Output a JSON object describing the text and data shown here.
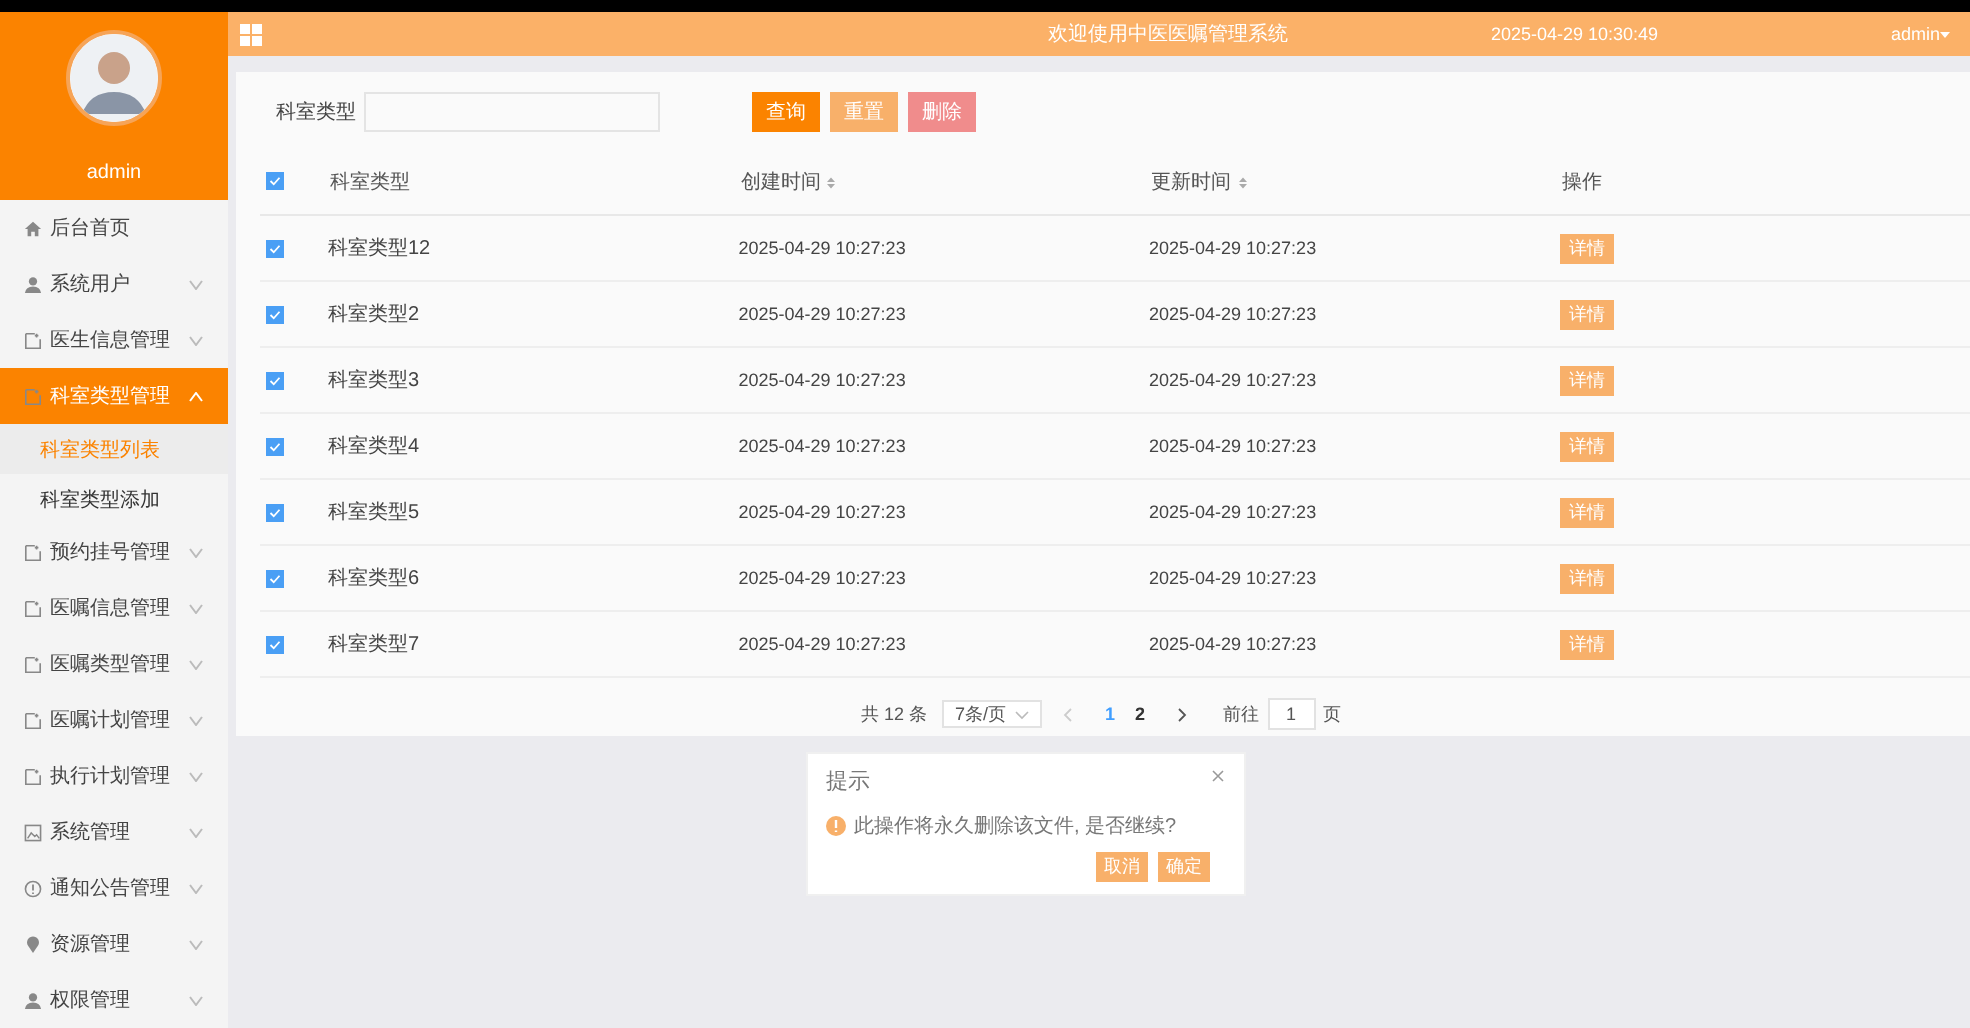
{
  "topbar": {
    "title": "欢迎使用中医医嘱管理系统",
    "datetime": "2025-04-29 10:30:49",
    "user": "admin"
  },
  "sidebar": {
    "username": "admin",
    "items": [
      {
        "label": "后台首页",
        "kind": "link",
        "selected": false
      },
      {
        "label": "系统用户",
        "kind": "submenu",
        "expanded": false,
        "selected": false
      },
      {
        "label": "医生信息管理",
        "kind": "submenu",
        "expanded": false,
        "selected": false
      },
      {
        "label": "科室类型管理",
        "kind": "submenu",
        "expanded": true,
        "selected": true,
        "children": [
          {
            "label": "科室类型列表",
            "selected": true
          },
          {
            "label": "科室类型添加",
            "selected": false
          }
        ]
      },
      {
        "label": "预约挂号管理",
        "kind": "submenu",
        "expanded": false,
        "selected": false
      },
      {
        "label": "医嘱信息管理",
        "kind": "submenu",
        "expanded": false,
        "selected": false
      },
      {
        "label": "医嘱类型管理",
        "kind": "submenu",
        "expanded": false,
        "selected": false
      },
      {
        "label": "医嘱计划管理",
        "kind": "submenu",
        "expanded": false,
        "selected": false
      },
      {
        "label": "执行计划管理",
        "kind": "submenu",
        "expanded": false,
        "selected": false
      },
      {
        "label": "系统管理",
        "kind": "submenu",
        "expanded": false,
        "selected": false
      },
      {
        "label": "通知公告管理",
        "kind": "submenu",
        "expanded": false,
        "selected": false
      },
      {
        "label": "资源管理",
        "kind": "submenu",
        "expanded": false,
        "selected": false
      },
      {
        "label": "权限管理",
        "kind": "submenu",
        "expanded": false,
        "selected": false
      }
    ]
  },
  "search": {
    "label": "科室类型"
  },
  "buttons": [
    {
      "label": "查询",
      "kind": "primary"
    },
    {
      "label": "重置",
      "kind": "warning"
    },
    {
      "label": "删除",
      "kind": "danger"
    }
  ],
  "table": {
    "header_checked": true,
    "columns": [
      {
        "label": "科室类型",
        "sortable": false
      },
      {
        "label": "创建时间",
        "sortable": true
      },
      {
        "label": "更新时间",
        "sortable": true
      },
      {
        "label": "操作",
        "sortable": false
      }
    ],
    "rows": [
      {
        "checked": true,
        "name": "科室类型12",
        "created": "2025-04-29 10:27:23",
        "updated": "2025-04-29 10:27:23",
        "action": "详情"
      },
      {
        "checked": true,
        "name": "科室类型2",
        "created": "2025-04-29 10:27:23",
        "updated": "2025-04-29 10:27:23",
        "action": "详情"
      },
      {
        "checked": true,
        "name": "科室类型3",
        "created": "2025-04-29 10:27:23",
        "updated": "2025-04-29 10:27:23",
        "action": "详情"
      },
      {
        "checked": true,
        "name": "科室类型4",
        "created": "2025-04-29 10:27:23",
        "updated": "2025-04-29 10:27:23",
        "action": "详情"
      },
      {
        "checked": true,
        "name": "科室类型5",
        "created": "2025-04-29 10:27:23",
        "updated": "2025-04-29 10:27:23",
        "action": "详情"
      },
      {
        "checked": true,
        "name": "科室类型6",
        "created": "2025-04-29 10:27:23",
        "updated": "2025-04-29 10:27:23",
        "action": "详情"
      },
      {
        "checked": true,
        "name": "科室类型7",
        "created": "2025-04-29 10:27:23",
        "updated": "2025-04-29 10:27:23",
        "action": "详情"
      }
    ]
  },
  "pagination": {
    "total": "共 12 条",
    "page_size": "7条/页",
    "pages": [
      {
        "label": "1",
        "selected": true
      },
      {
        "label": "2",
        "selected": false
      }
    ],
    "goto_label": "前往",
    "goto_value": "1",
    "goto_suffix": "页"
  },
  "dialog": {
    "title": "提示",
    "message": "此操作将永久删除该文件, 是否继续?",
    "buttons": [
      {
        "label": "取消"
      },
      {
        "label": "确定"
      }
    ]
  }
}
